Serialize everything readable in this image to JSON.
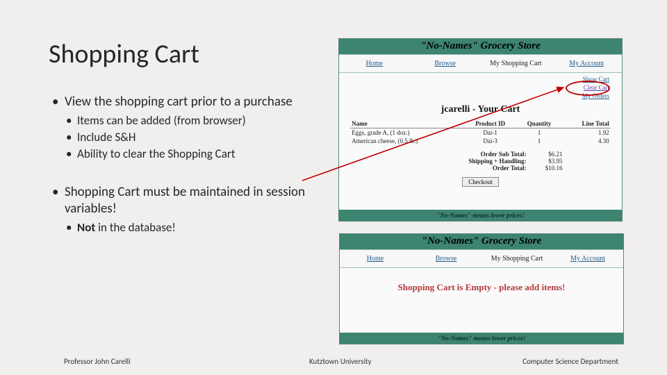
{
  "title": "Shopping Cart",
  "bullets": {
    "b1": "View the shopping cart prior to a purchase",
    "b1a": "Items can be added (from browser)",
    "b1b": "Include S&H",
    "b1c": "Ability to clear the Shopping Cart",
    "b2": "Shopping Cart must be maintained in session variables!",
    "b3_pre": "Not",
    "b3_post": " in the database!"
  },
  "store": {
    "name": "\"No-Names\" Grocery Store",
    "footer": "\"No-Names\" means lower prices!",
    "nav": {
      "home": "Home",
      "browse": "Browse",
      "cart": "My Shopping Cart",
      "account": "My Account"
    },
    "sublinks": {
      "show": "Show Cart",
      "clear": "Clear Cart",
      "orders": "My Orders"
    }
  },
  "cart": {
    "title": "jcarelli - Your Cart",
    "headers": {
      "name": "Name",
      "pid": "Product ID",
      "qty": "Quantity",
      "total": "Line Total"
    },
    "rows": [
      {
        "name": "Eggs, grade A, (1 doz.)",
        "pid": "Dai-1",
        "qty": "1",
        "total": "1.92"
      },
      {
        "name": "American cheese, (0.5 lb.)",
        "pid": "Dai-3",
        "qty": "1",
        "total": "4.30"
      }
    ],
    "totals": {
      "sub_lbl": "Order Sub Total:",
      "sub_val": "$6.21",
      "sh_lbl": "Shipping + Handling:",
      "sh_val": "$3.95",
      "tot_lbl": "Order Total:",
      "tot_val": "$10.16"
    },
    "checkout": "Checkout"
  },
  "empty_msg": "Shopping Cart is Empty - please add items!",
  "footer": {
    "left": "Professor John Carelli",
    "center": "Kutztown University",
    "right": "Computer Science Department"
  }
}
